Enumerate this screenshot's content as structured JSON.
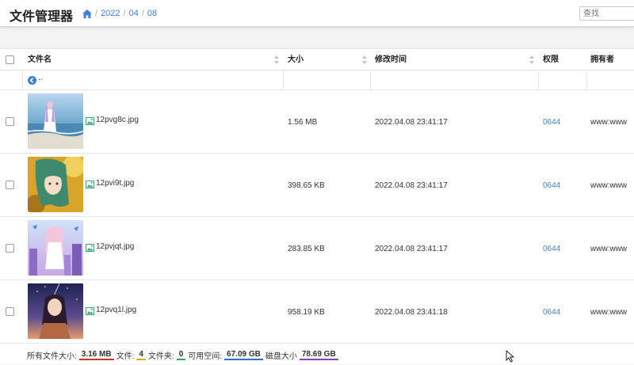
{
  "app": {
    "title": "文件管理器"
  },
  "breadcrumb": {
    "items": [
      "2022",
      "04",
      "08"
    ],
    "separator": "/"
  },
  "search": {
    "placeholder": "查找",
    "value": ""
  },
  "table": {
    "headers": {
      "name": "文件名",
      "size": "大小",
      "modified": "修改时间",
      "permissions": "权限",
      "owner": "拥有者"
    },
    "parent_dir_label": ".."
  },
  "files": [
    {
      "name": "12pvg8c.jpg",
      "size": "1.56 MB",
      "modified": "2022.04.08 23:41:17",
      "permissions": "0644",
      "owner": "www:www"
    },
    {
      "name": "12pvi9t.jpg",
      "size": "398.65 KB",
      "modified": "2022.04.08 23:41:17",
      "permissions": "0644",
      "owner": "www:www"
    },
    {
      "name": "12pvjqt.jpg",
      "size": "283.85 KB",
      "modified": "2022.04.08 23:41:17",
      "permissions": "0644",
      "owner": "www:www"
    },
    {
      "name": "12pvq1l.jpg",
      "size": "958.19 KB",
      "modified": "2022.04.08 23:41:18",
      "permissions": "0644",
      "owner": "www:www"
    }
  ],
  "footer": {
    "total_size_label": "所有文件大小:",
    "total_size": "3.16 MB",
    "files_label": "文件:",
    "files_count": "4",
    "folders_label": "文件夹:",
    "folders_count": "0",
    "free_label": "可用空间:",
    "free_space": "67.09 GB",
    "disk_label": "磁盘大小",
    "disk_size": "78.69 GB"
  },
  "colors": {
    "accent": "#3d80d8",
    "total_size_underline": "#c0392b",
    "files_underline": "#e6a817",
    "folders_underline": "#27ae60",
    "free_underline": "#2e6fd1",
    "disk_underline": "#8e44ad"
  },
  "icons": [
    "home-icon",
    "sort-icon",
    "back-arrow-icon",
    "image-file-icon",
    "mouse-cursor-icon"
  ]
}
